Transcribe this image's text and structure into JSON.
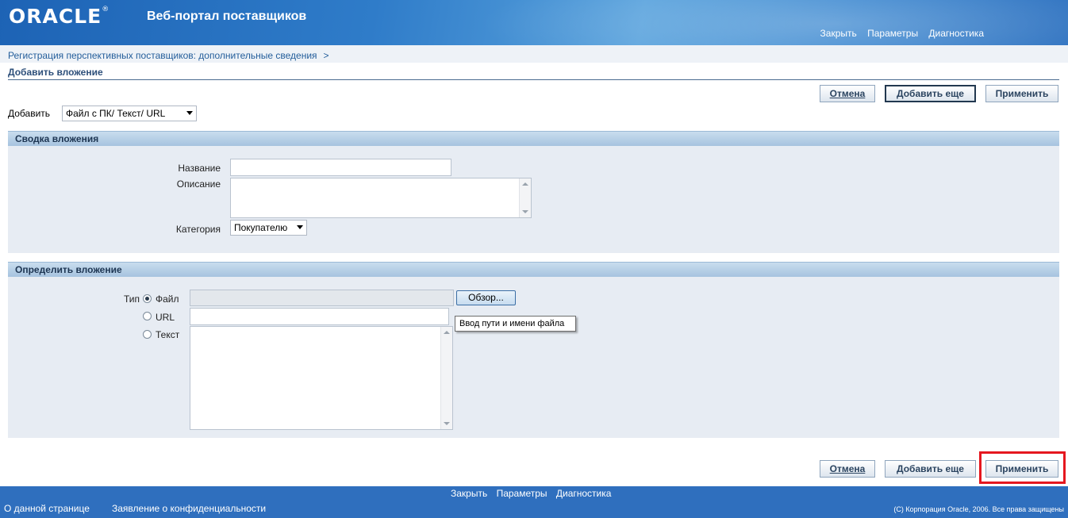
{
  "header": {
    "logo": "ORACLE",
    "logo_mark": "®",
    "title": "Веб-портал поставщиков",
    "links": [
      "Закрыть",
      "Параметры",
      "Диагностика"
    ]
  },
  "breadcrumb": {
    "item": "Регистрация перспективных поставщиков: дополнительные сведения",
    "separator": ">"
  },
  "page_title": "Добавить вложение",
  "buttons": {
    "cancel": "Отмена",
    "add_more": "Добавить еще",
    "apply": "Применить"
  },
  "add": {
    "label": "Добавить",
    "selected": "Файл с ПК/ Текст/ URL"
  },
  "summary": {
    "header": "Сводка вложения",
    "name_label": "Название",
    "name_value": "",
    "desc_label": "Описание",
    "desc_value": "",
    "category_label": "Категория",
    "category_selected": "Покупателю"
  },
  "define": {
    "header": "Определить вложение",
    "type_label": "Тип",
    "options": [
      "Файл",
      "URL",
      "Текст"
    ],
    "selected_option": "Файл",
    "browse": "Обзор...",
    "tooltip": "Ввод пути и имени файла",
    "url_value": "",
    "text_value": ""
  },
  "footer": {
    "links": [
      "Закрыть",
      "Параметры",
      "Диагностика"
    ],
    "about": "О данной странице",
    "privacy": "Заявление о конфиденциальности",
    "copyright": "(C) Корпорация Oracle, 2006. Все права защищены"
  }
}
